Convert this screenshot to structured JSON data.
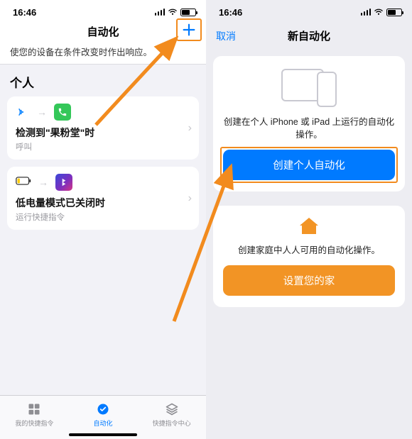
{
  "status": {
    "time_left": "16:46",
    "time_right": "16:46"
  },
  "left": {
    "title": "自动化",
    "subtitle": "使您的设备在条件改变时作出响应。",
    "section": "个人",
    "card1": {
      "title": "检测到\"果粉堂\"时",
      "sub": "呼叫"
    },
    "card2": {
      "title": "低电量模式已关闭时",
      "sub": "运行快捷指令"
    },
    "tabs": {
      "shortcuts": "我的快捷指令",
      "automation": "自动化",
      "gallery": "快捷指令中心"
    }
  },
  "right": {
    "cancel": "取消",
    "title": "新自动化",
    "personal_desc": "创建在个人 iPhone 或 iPad 上运行的自动化操作。",
    "personal_btn": "创建个人自动化",
    "home_desc": "创建家庭中人人可用的自动化操作。",
    "home_btn": "设置您的家"
  }
}
